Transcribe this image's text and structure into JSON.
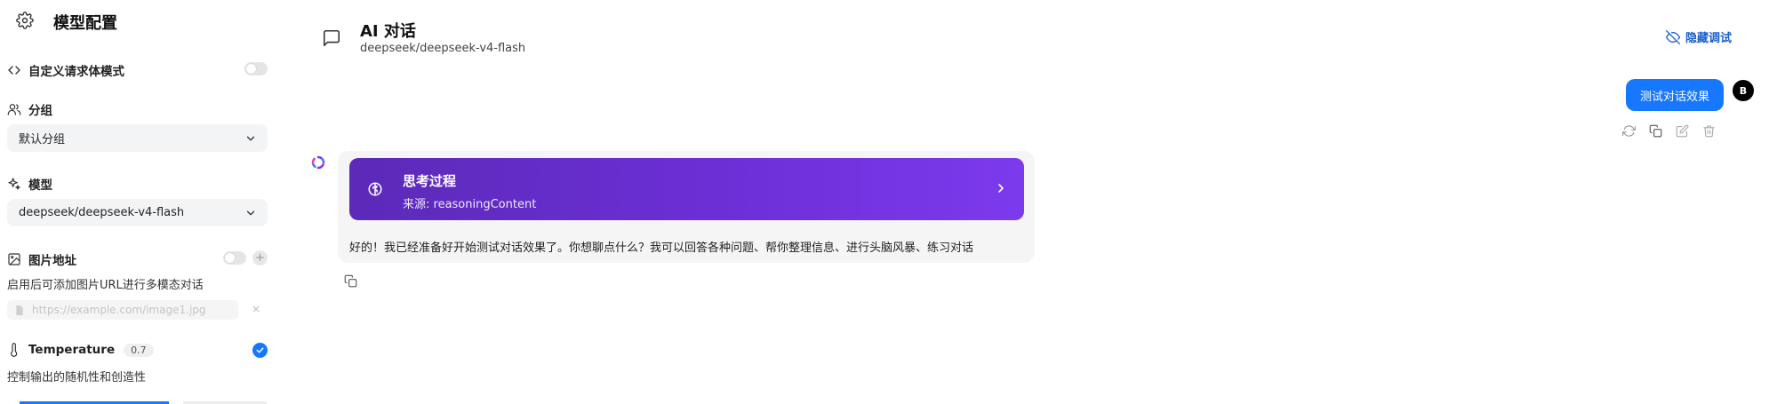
{
  "sidebar": {
    "title": "模型配置",
    "custom_body": {
      "label": "自定义请求体模式"
    },
    "group": {
      "label": "分组",
      "value": "默认分组"
    },
    "model": {
      "label": "模型",
      "value": "deepseek/deepseek-v4-flash"
    },
    "image": {
      "label": "图片地址",
      "helper": "启用后可添加图片URL进行多模态对话",
      "placeholder": "https://example.com/image1.jpg",
      "clear": "×",
      "add": "+"
    },
    "temperature": {
      "label": "Temperature",
      "value": "0.7",
      "helper": "控制输出的随机性和创造性"
    }
  },
  "header": {
    "title": "AI 对话",
    "subtitle": "deepseek/deepseek-v4-flash",
    "hide_debug": "隐藏调试"
  },
  "messages": {
    "user": {
      "text": "测试对话效果",
      "avatar": "B"
    },
    "assistant": {
      "thinking_title": "思考过程",
      "thinking_source": "来源: reasoningContent",
      "text": "好的！我已经准备好开始测试对话效果了。你想聊点什么？我可以回答各种问题、帮你整理信息、进行头脑风暴、练习对话"
    }
  },
  "colors": {
    "accent": "#1677ff",
    "thinking_gradient_start": "#5b2ab8",
    "thinking_gradient_end": "#7c3aed",
    "link": "#1a5fd0"
  },
  "icons": [
    "gear-icon",
    "code-icon",
    "users-icon",
    "sparkle-icon",
    "image-icon",
    "thermometer-icon",
    "chevron-down-icon",
    "chat-icon",
    "eye-off-icon",
    "refresh-icon",
    "copy-icon",
    "edit-icon",
    "trash-icon",
    "brain-icon",
    "chevron-right-icon",
    "check-icon",
    "file-icon"
  ]
}
